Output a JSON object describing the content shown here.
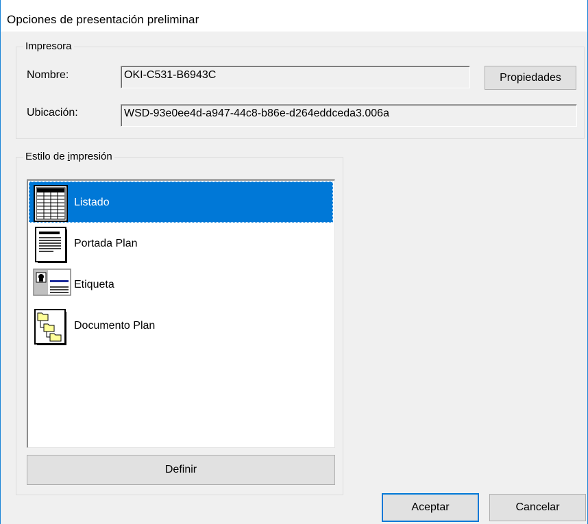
{
  "window": {
    "title": "Opciones de presentación preliminar"
  },
  "printer": {
    "legend": "Impresora",
    "name_label": "Nombre:",
    "name_value": "OKI-C531-B6943C",
    "properties_label": "Propiedades",
    "location_label": "Ubicación:",
    "location_value": "WSD-93e0ee4d-a947-44c8-b86e-d264eddceda3.006a"
  },
  "print_style": {
    "legend_pre": "Estilo de ",
    "legend_accel": "i",
    "legend_post": "mpresión",
    "items": [
      {
        "label": "Listado",
        "icon": "table-list-icon",
        "selected": true
      },
      {
        "label": "Portada Plan",
        "icon": "document-page-icon",
        "selected": false
      },
      {
        "label": "Etiqueta",
        "icon": "label-card-icon",
        "selected": false
      },
      {
        "label": "Documento Plan",
        "icon": "folder-tree-icon",
        "selected": false
      }
    ],
    "define_label": "Definir"
  },
  "footer": {
    "accept_label": "Aceptar",
    "cancel_label": "Cancelar"
  },
  "colors": {
    "selection": "#0078d7",
    "window_border": "#1883d7",
    "dialog_bg": "#f0f0f0"
  }
}
